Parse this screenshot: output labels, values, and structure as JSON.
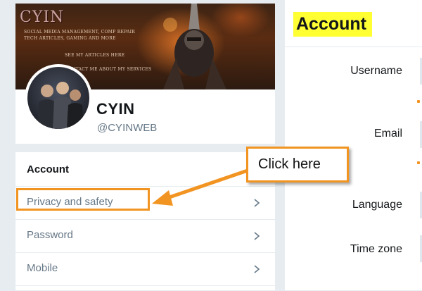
{
  "profile": {
    "banner_title": "CYIN",
    "banner_lines": [
      "SOCIAL MEDIA MANAGEMENT, COMP REPAIR",
      "TECH ARTICLES, GAMING AND MORE",
      "SEE MY ARTICLES HERE",
      "CONTACT ME ABOUT MY SERVICES"
    ],
    "name": "CYIN",
    "handle": "@CYINWEB"
  },
  "settings_menu": {
    "heading": "Account",
    "items": [
      {
        "label": "Privacy and safety",
        "highlighted": true
      },
      {
        "label": "Password"
      },
      {
        "label": "Mobile"
      }
    ]
  },
  "annotation": {
    "callout_text": "Click here",
    "accent_color": "#f29421"
  },
  "account_panel": {
    "title": "Account",
    "title_highlight": "#ffff33",
    "fields": [
      {
        "label": "Username"
      },
      {
        "label": "Email"
      },
      {
        "label": "Language"
      },
      {
        "label": "Time zone"
      }
    ]
  },
  "icons": {
    "chevron": "chevron-right-icon"
  }
}
